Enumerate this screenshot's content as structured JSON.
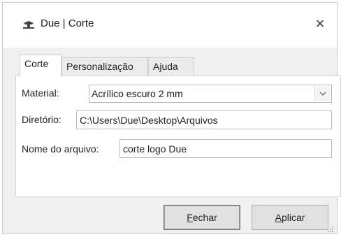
{
  "window": {
    "title": "Due | Corte",
    "close_symbol": "×",
    "icon": "sewing-machine-icon"
  },
  "tabs": [
    {
      "label": "Corte",
      "active": true
    },
    {
      "label": "Personalização",
      "active": false
    },
    {
      "label": "Ajuda",
      "active": false
    }
  ],
  "form": {
    "material_label": "Material:",
    "material_value": "Acrílico escuro 2 mm",
    "directory_label": "Diretório:",
    "directory_value": "C:\\Users\\Due\\Desktop\\Arquivos",
    "filename_label": "Nome do arquivo:",
    "filename_value": "corte logo Due"
  },
  "buttons": {
    "close_label": "Fechar",
    "apply_label": "Aplicar"
  },
  "colors": {
    "window_bg": "#f0f0f0",
    "panel_bg": "#ffffff",
    "button_bg": "#e1e1e1"
  }
}
